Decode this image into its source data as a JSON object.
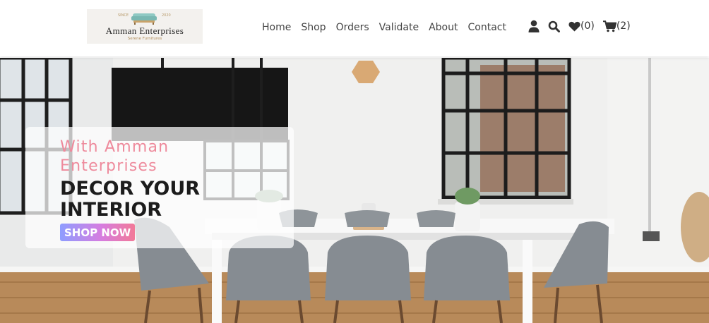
{
  "logo": {
    "brand": "Amman Enterprises",
    "tagline": "Serene Furnitures",
    "since": "SINCE",
    "year": "2020"
  },
  "nav": {
    "items": [
      "Home",
      "Shop",
      "Orders",
      "Validate",
      "About",
      "Contact"
    ]
  },
  "header_icons": {
    "account_icon": "user-icon",
    "search_icon": "search-icon",
    "wishlist_icon": "heart-icon",
    "wishlist_count": "(0)",
    "cart_icon": "cart-icon",
    "cart_count": "(2)"
  },
  "hero": {
    "pre_title": "With Amman Enterprises",
    "title": "DECOR YOUR INTERIOR",
    "cta": "SHOP NOW"
  },
  "colors": {
    "accent_pink": "#ee8a9c",
    "button_gradient_start": "#8e9dff",
    "button_gradient_end": "#f27a98",
    "nav_text": "#444444"
  }
}
